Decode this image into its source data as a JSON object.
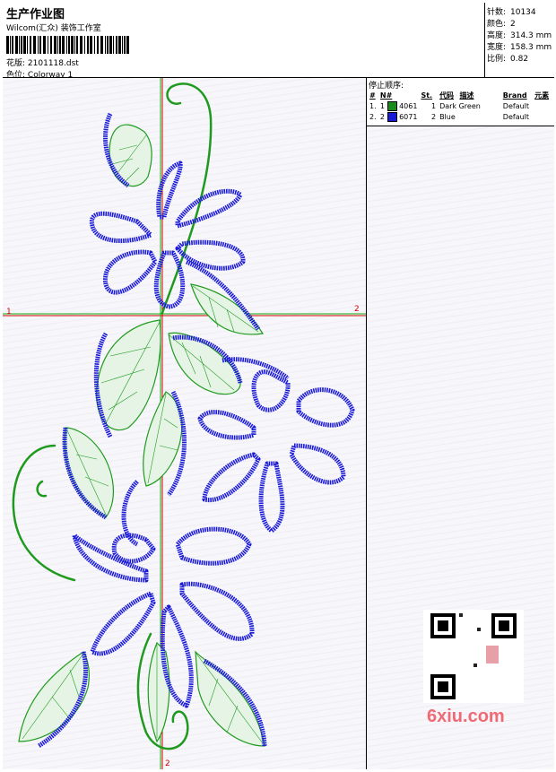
{
  "header": {
    "title": "生产作业图",
    "studio": "Wilcom(汇众) 装饰工作室",
    "design_label": "花版:",
    "design_file": "2101118.dst",
    "colorway_label": "色位:",
    "colorway": "Colorway 1"
  },
  "specs": [
    {
      "key": "针数:",
      "value": "10134"
    },
    {
      "key": "颜色:",
      "value": "2"
    },
    {
      "key": "高度:",
      "value": "314.3 mm"
    },
    {
      "key": "宽度:",
      "value": "158.3 mm"
    },
    {
      "key": "比例:",
      "value": "0.82"
    }
  ],
  "stop_sequence": {
    "title": "停止顺序:",
    "columns": [
      "#",
      "N#",
      "St.",
      "代码",
      "描述",
      "Brand",
      "元素"
    ],
    "rows": [
      {
        "index": "1.",
        "n": "1",
        "code": "4061",
        "st": "1",
        "desc": "Dark Green",
        "brand": "Default",
        "color": "#1a8a1a"
      },
      {
        "index": "2.",
        "n": "2",
        "code": "6071",
        "st": "2",
        "desc": "Blue",
        "brand": "Default",
        "color": "#1a1ad6"
      }
    ]
  },
  "axis_labels": {
    "left": "1",
    "right": "2",
    "bottom": "2"
  },
  "watermark": "6xiu.com",
  "colors": {
    "green": "#1f9a1f",
    "blue": "#1b1bd8",
    "axis_red": "#d00000",
    "axis_green": "#10b010"
  }
}
